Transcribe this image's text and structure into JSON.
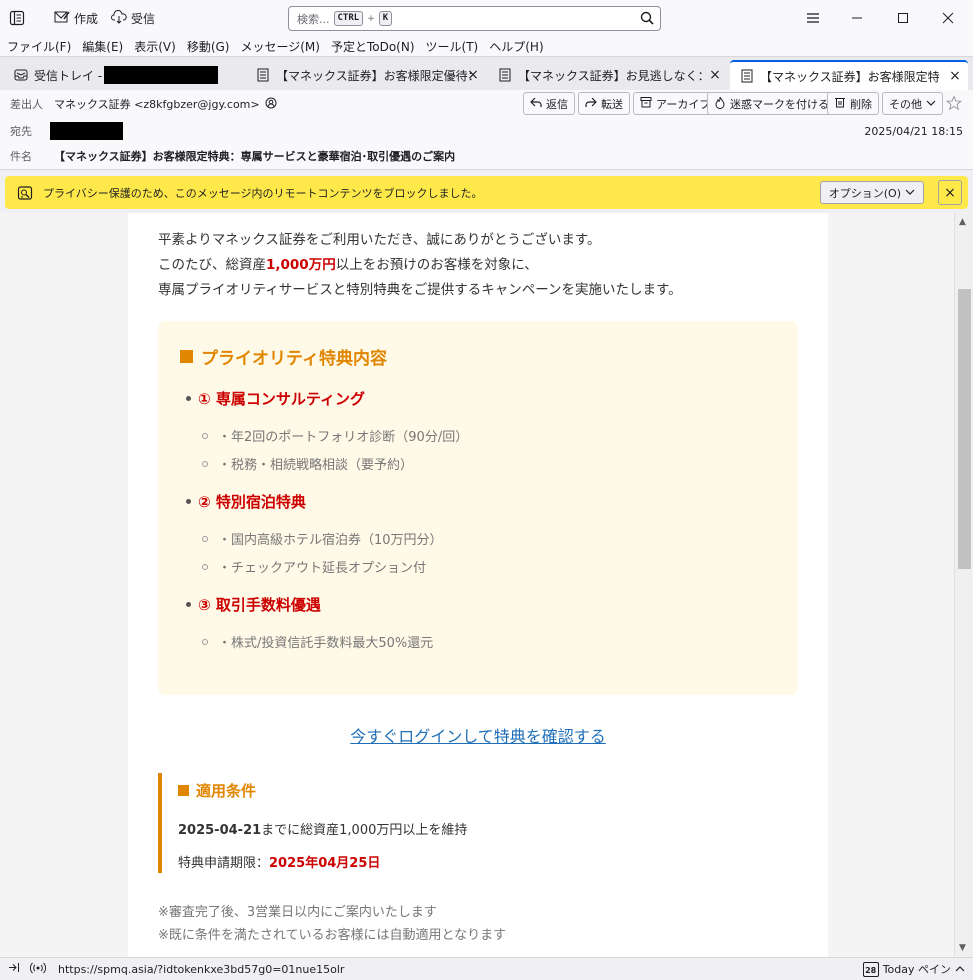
{
  "titlebar": {
    "compose_label": "作成",
    "receive_label": "受信",
    "search_placeholder": "検索...",
    "search_key1": "CTRL",
    "search_plus": "+",
    "search_key2": "K"
  },
  "menu": [
    "ファイル(F)",
    "編集(E)",
    "表示(V)",
    "移動(G)",
    "メッセージ(M)",
    "予定とToDo(N)",
    "ツール(T)",
    "ヘルプ(H)"
  ],
  "tabs": [
    {
      "label": "受信トレイ -"
    },
    {
      "label": "【マネックス証券】お客様限定優待：高"
    },
    {
      "label": "【マネックス証券】お見逃しなく：高配"
    },
    {
      "label": "【マネックス証券】お客様限定特典：専"
    }
  ],
  "header": {
    "from_label": "差出人",
    "from_value": "マネックス証券 <z8kfgbzer@jgy.com>",
    "to_label": "宛先",
    "subject_label": "件名",
    "subject_value": "【マネックス証券】お客様限定特典：専属サービスと豪華宿泊･取引優遇のご案内",
    "date": "2025/04/21 18:15",
    "buttons": {
      "reply": "返信",
      "forward": "転送",
      "archive": "アーカイブ",
      "junk": "迷惑マークを付ける",
      "delete": "削除",
      "more": "その他"
    }
  },
  "privacy": {
    "text": "プライバシー保護のため、このメッセージ内のリモートコンテンツをブロックしました。",
    "options_label": "オプション(O)"
  },
  "body": {
    "intro_line1": "平素よりマネックス証券をご利用いただき、誠にありがとうございます。",
    "intro_line2_a": "このたび、総資産",
    "intro_line2_amount": "1,000万円",
    "intro_line2_b": "以上をお預けのお客様を対象に、",
    "intro_line3": "専属プライオリティサービスと特別特典をご提供するキャンペーンを実施いたします。",
    "benefits_title": "プライオリティ特典内容",
    "benefits": [
      {
        "title": "① 専属コンサルティング",
        "items": [
          "・年2回のポートフォリオ診断（90分/回）",
          "・税務・相続戦略相談（要予約）"
        ]
      },
      {
        "title": "② 特別宿泊特典",
        "items": [
          "・国内高級ホテル宿泊券（10万円分）",
          "・チェックアウト延長オプション付"
        ]
      },
      {
        "title": "③ 取引手数料優遇",
        "items": [
          "・株式/投資信託手数料最大50%還元"
        ]
      }
    ],
    "cta_link": "今すぐログインして特典を確認する",
    "conditions_title": "適用条件",
    "condition_date": "2025-04-21",
    "condition_text": "までに総資産1,000万円以上を維持",
    "deadline_label": "特典申請期限：",
    "deadline_value": "2025年04月25日",
    "note1": "※審査完了後、3営業日以内にご案内いたします",
    "note2": "※既に条件を満たされているお客様には自動適用となります"
  },
  "status": {
    "url": "https://spmq.asia/?idtokenkxe3bd57g0=01nue15olr",
    "calendar_day": "28",
    "today_label": "Today ペイン"
  },
  "colors": {
    "accent_orange": "#e08600",
    "accent_red": "#cc0000",
    "link_blue": "#1e6fb8",
    "privacy_yellow": "#ffe94a"
  }
}
